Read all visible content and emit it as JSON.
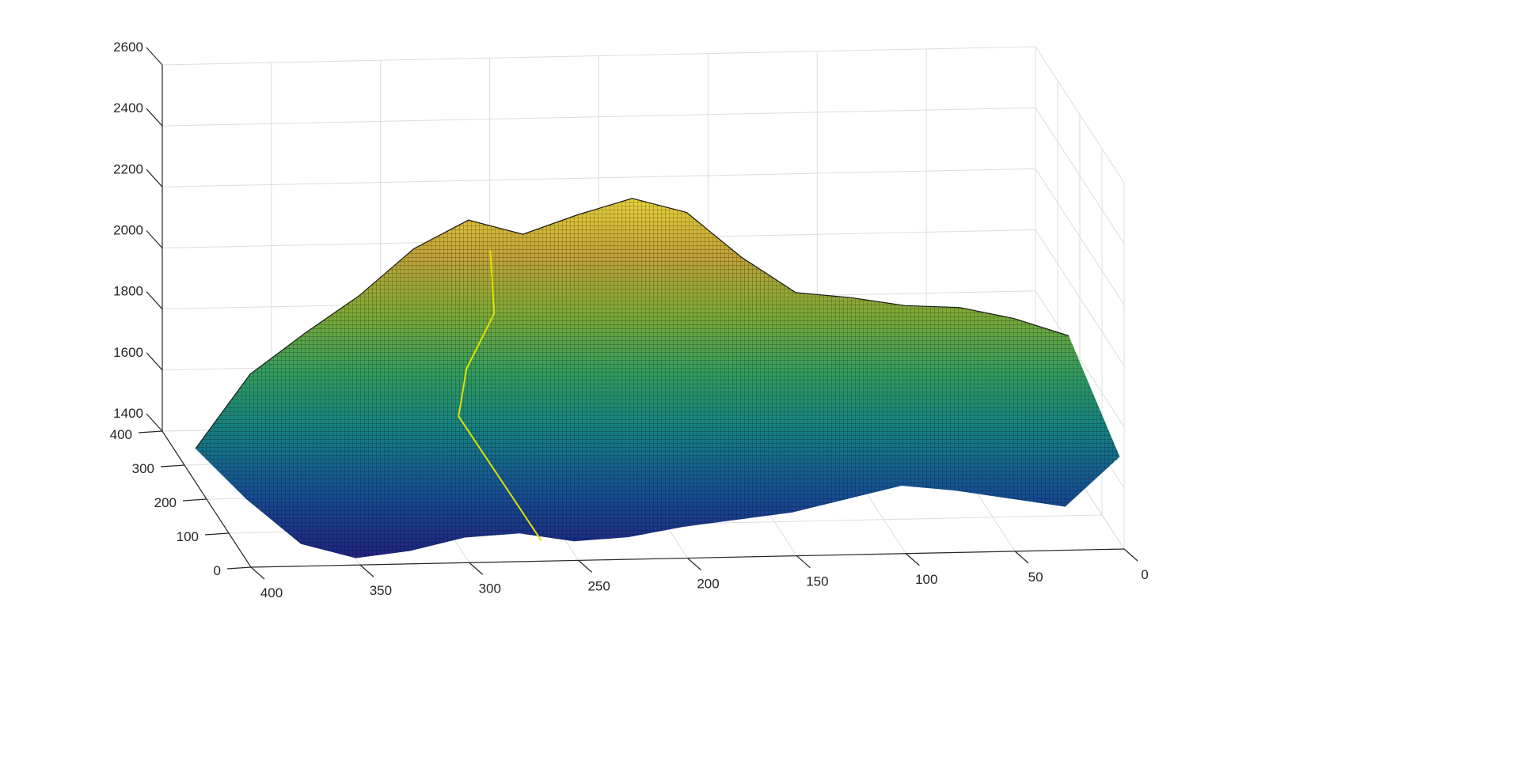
{
  "chart_data": {
    "type": "surface3d",
    "title": "",
    "xlabel": "",
    "ylabel": "",
    "zlabel": "",
    "colormap": "parula",
    "mesh_edge_color": "#000000",
    "grid": true,
    "xlim": [
      0,
      400
    ],
    "ylim": [
      0,
      400
    ],
    "zlim": [
      1400,
      2600
    ],
    "x_ticks": [
      "0",
      "50",
      "100",
      "150",
      "200",
      "250",
      "300",
      "350",
      "400"
    ],
    "y_ticks": [
      "0",
      "100",
      "200",
      "300",
      "400"
    ],
    "z_ticks": [
      "1400",
      "1600",
      "1800",
      "2000",
      "2200",
      "2400",
      "2600"
    ],
    "surface_profile": {
      "description_x_values": [
        400,
        375,
        350,
        325,
        300,
        275,
        250,
        225,
        200,
        175,
        150,
        125,
        100,
        75,
        50,
        25,
        0
      ],
      "ridge_top_z": [
        1510,
        1750,
        1880,
        2000,
        2150,
        2240,
        2190,
        2250,
        2300,
        2250,
        2100,
        1980,
        1960,
        1930,
        1920,
        1880,
        1820
      ],
      "front_bottom_z": [
        1600,
        1450,
        1400,
        1420,
        1460,
        1470,
        1440,
        1450,
        1480,
        1500,
        1520,
        1560,
        1600,
        1580,
        1550,
        1520,
        1680
      ]
    },
    "highlight_line": {
      "color": "#e0e000",
      "x_value": 265
    }
  }
}
